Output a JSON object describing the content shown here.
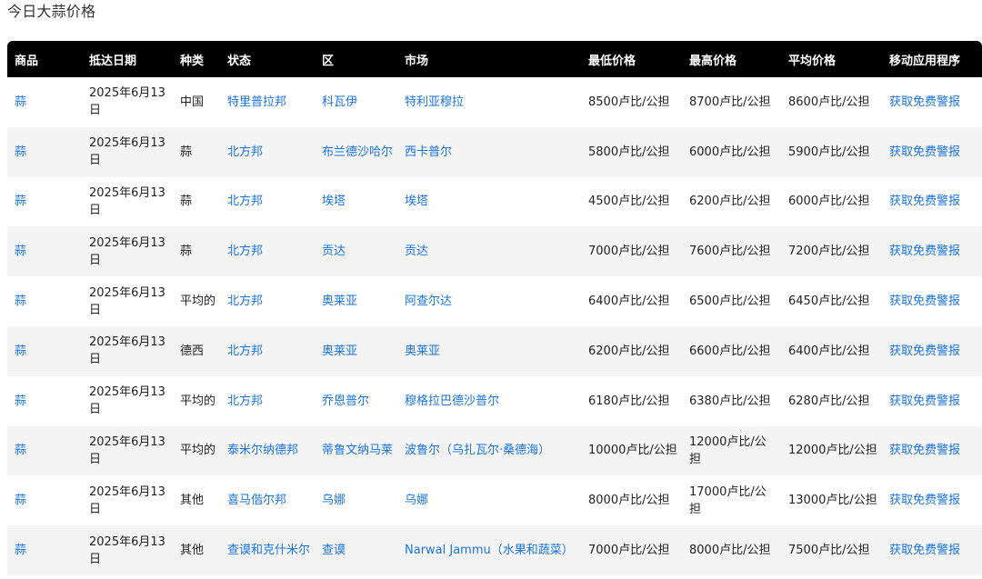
{
  "page": {
    "title": "今日大蒜价格"
  },
  "table": {
    "headers": [
      "商品",
      "抵达日期",
      "种类",
      "状态",
      "区",
      "市场",
      "最低价格",
      "最高价格",
      "平均价格",
      "移动应用程序"
    ],
    "rows": [
      {
        "commodity": "蒜",
        "date": "2025年6月13日",
        "variety": "中国",
        "state": "特里普拉邦",
        "district": "科瓦伊",
        "market": "特利亚穆拉",
        "min": "8500卢比/公担",
        "max": "8700卢比/公担",
        "avg": "8600卢比/公担",
        "app": "获取免费警报"
      },
      {
        "commodity": "蒜",
        "date": "2025年6月13日",
        "variety": "蒜",
        "state": "北方邦",
        "district": "布兰德沙哈尔",
        "market": "西卡普尔",
        "min": "5800卢比/公担",
        "max": "6000卢比/公担",
        "avg": "5900卢比/公担",
        "app": "获取免费警报"
      },
      {
        "commodity": "蒜",
        "date": "2025年6月13日",
        "variety": "蒜",
        "state": "北方邦",
        "district": "埃塔",
        "market": "埃塔",
        "min": "4500卢比/公担",
        "max": "6200卢比/公担",
        "avg": "6000卢比/公担",
        "app": "获取免费警报"
      },
      {
        "commodity": "蒜",
        "date": "2025年6月13日",
        "variety": "蒜",
        "state": "北方邦",
        "district": "贡达",
        "market": "贡达",
        "min": "7000卢比/公担",
        "max": "7600卢比/公担",
        "avg": "7200卢比/公担",
        "app": "获取免费警报"
      },
      {
        "commodity": "蒜",
        "date": "2025年6月13日",
        "variety": "平均的",
        "state": "北方邦",
        "district": "奥莱亚",
        "market": "阿查尔达",
        "min": "6400卢比/公担",
        "max": "6500卢比/公担",
        "avg": "6450卢比/公担",
        "app": "获取免费警报"
      },
      {
        "commodity": "蒜",
        "date": "2025年6月13日",
        "variety": "德西",
        "state": "北方邦",
        "district": "奥莱亚",
        "market": "奥莱亚",
        "min": "6200卢比/公担",
        "max": "6600卢比/公担",
        "avg": "6400卢比/公担",
        "app": "获取免费警报"
      },
      {
        "commodity": "蒜",
        "date": "2025年6月13日",
        "variety": "平均的",
        "state": "北方邦",
        "district": "乔恩普尔",
        "market": "穆格拉巴德沙普尔",
        "min": "6180卢比/公担",
        "max": "6380卢比/公担",
        "avg": "6280卢比/公担",
        "app": "获取免费警报"
      },
      {
        "commodity": "蒜",
        "date": "2025年6月13日",
        "variety": "平均的",
        "state": "泰米尔纳德邦",
        "district": "蒂鲁文纳马莱",
        "market": "波鲁尔（乌扎瓦尔·桑德海）",
        "min": "10000卢比/公担",
        "max": "12000卢比/公担",
        "avg": "12000卢比/公担",
        "app": "获取免费警报"
      },
      {
        "commodity": "蒜",
        "date": "2025年6月13日",
        "variety": "其他",
        "state": "喜马偕尔邦",
        "district": "乌娜",
        "market": "乌娜",
        "min": "8000卢比/公担",
        "max": "17000卢比/公担",
        "avg": "13000卢比/公担",
        "app": "获取免费警报"
      },
      {
        "commodity": "蒜",
        "date": "2025年6月13日",
        "variety": "其他",
        "state": "查谟和克什米尔",
        "district": "查谟",
        "market": "Narwal Jammu（水果和蔬菜）",
        "min": "7000卢比/公担",
        "max": "8000卢比/公担",
        "avg": "7500卢比/公担",
        "app": "获取免费警报"
      }
    ]
  },
  "colors": {
    "header_bg": "#000000",
    "header_text": "#ffffff",
    "link": "#1a73d9",
    "stripe": "#f4f4f4"
  }
}
